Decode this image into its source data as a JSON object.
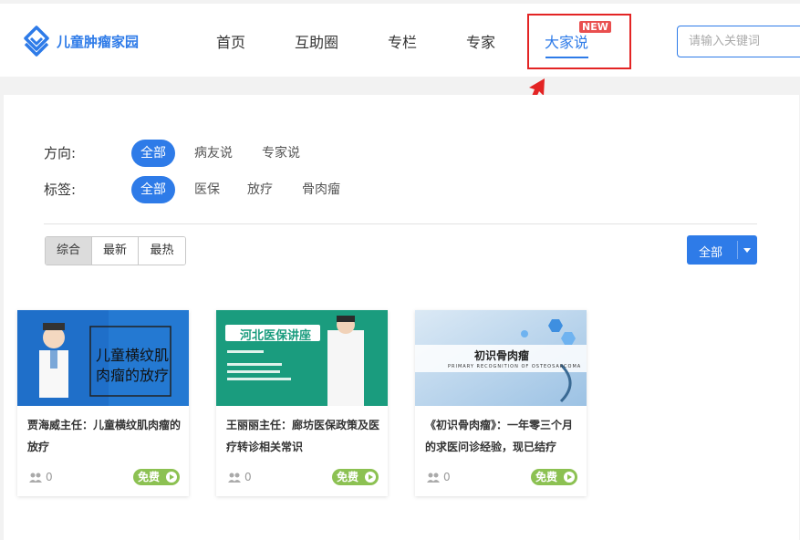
{
  "header": {
    "logo_text": "儿童肿瘤家园",
    "nav": [
      {
        "label": "首页"
      },
      {
        "label": "互助圈"
      },
      {
        "label": "专栏"
      },
      {
        "label": "专家"
      },
      {
        "label": "大家说"
      }
    ],
    "new_badge": "NEW",
    "search_placeholder": "请输入关键词"
  },
  "filters": {
    "direction": {
      "label": "方向:",
      "options": [
        "全部",
        "病友说",
        "专家说"
      ],
      "selected": "全部"
    },
    "tags": {
      "label": "标签:",
      "options": [
        "全部",
        "医保",
        "放疗",
        "骨肉瘤"
      ],
      "selected": "全部"
    }
  },
  "sort": {
    "options": [
      "综合",
      "最新",
      "最热"
    ],
    "selected": "综合"
  },
  "dropdown": {
    "label": "全部"
  },
  "cards": [
    {
      "title": "贾海威主任：儿童横纹肌肉瘤的放疗",
      "thumb_text": [
        "儿童横纹肌",
        "肉瘤的放疗"
      ],
      "count": "0",
      "badge": "免费"
    },
    {
      "title": "王丽丽主任：廊坊医保政策及医疗转诊相关常识",
      "thumb_text": [
        "河北医保讲座"
      ],
      "count": "0",
      "badge": "免费"
    },
    {
      "title": "《初识骨肉瘤》：一年零三个月的求医问诊经验，现已结疗",
      "thumb_text": [
        "初识骨肉瘤",
        "PRIMARY RECOGNITION OF OSTEOSARCOMA"
      ],
      "count": "0",
      "badge": "免费"
    }
  ],
  "colors": {
    "accent": "#2e7be8",
    "highlight": "#e32424",
    "free": "#8cc152",
    "new_badge": "#e94f4f"
  },
  "icons": [
    "logo-icon",
    "users-icon",
    "play-icon",
    "caret-down-icon",
    "annotation-arrow"
  ]
}
